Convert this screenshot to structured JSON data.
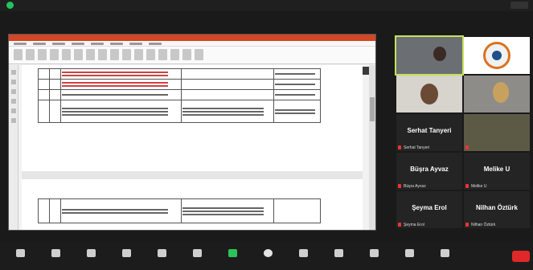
{
  "window": {
    "title": ""
  },
  "document": {
    "title": "",
    "menu": [
      "",
      "",
      "",
      "",
      "",
      "",
      "",
      "",
      ""
    ],
    "rows": [
      {
        "col1": "",
        "col2": "",
        "col3": "",
        "col4": "",
        "col5": ""
      },
      {
        "col1": "",
        "col2": "",
        "col3": "",
        "col4": "",
        "col5": ""
      },
      {
        "col1": "",
        "col2": "",
        "col3": "",
        "col4": "",
        "col5": ""
      },
      {
        "col1": "",
        "col2": "",
        "col3": "",
        "col4": "",
        "col5": ""
      }
    ],
    "lower_row": {
      "col1": "",
      "col2": "",
      "col3": "",
      "col4": ""
    }
  },
  "participants": {
    "tiles": [
      {
        "caption": ""
      },
      {
        "caption": ""
      },
      {
        "caption": ""
      },
      {
        "caption": ""
      },
      {
        "name": "Serhat Tanyeri",
        "caption": "Serhat Tanyeri"
      },
      {
        "caption": ""
      },
      {
        "name": "Büşra Ayvaz",
        "caption": "Büşra Ayvaz"
      },
      {
        "name": "Melike U",
        "caption": "Melike U"
      },
      {
        "name": "Şeyma Erol",
        "caption": "Şeyma Erol"
      },
      {
        "name": "Nilhan Öztürk",
        "caption": "Nilhan Öztürk"
      }
    ]
  },
  "toolbar": {
    "buttons": [
      "",
      "",
      "",
      "",
      "",
      "",
      "",
      "",
      "",
      "",
      "",
      "",
      "",
      ""
    ],
    "end": ""
  },
  "colors": {
    "accent_green": "#22c35e",
    "share_green": "#2ec25a",
    "end_red": "#e02828",
    "doc_title": "#d24726"
  }
}
